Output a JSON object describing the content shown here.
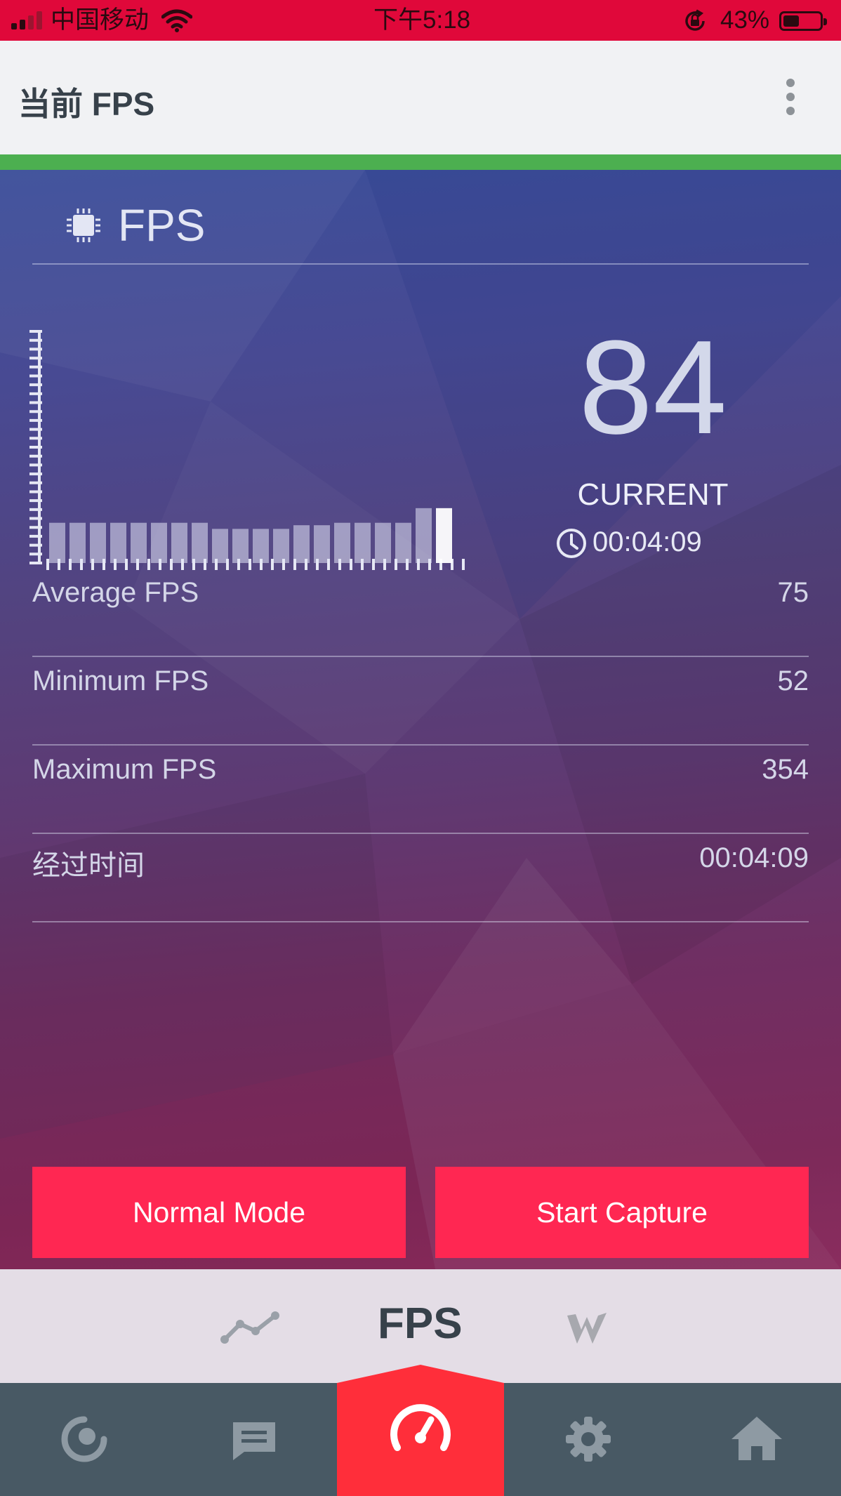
{
  "status_bar": {
    "carrier": "中国移动",
    "time": "下午5:18",
    "battery_text": "43%",
    "battery_level": 0.43,
    "icons": [
      "signal-icon",
      "wifi-icon",
      "rotation-lock-icon",
      "battery-icon"
    ]
  },
  "app_bar": {
    "title": "当前 FPS",
    "menu_icon": "more-vertical-icon"
  },
  "fps_panel": {
    "title": "FPS",
    "icon": "chip-icon",
    "current_value": "84",
    "current_label": "CURRENT",
    "current_time": "00:04:09",
    "clock_icon": "clock-icon"
  },
  "stats": [
    {
      "label": "Average FPS",
      "value": "75"
    },
    {
      "label": "Minimum FPS",
      "value": "52"
    },
    {
      "label": "Maximum FPS",
      "value": "354"
    },
    {
      "label": "经过时间",
      "value": "00:04:09"
    }
  ],
  "buttons": {
    "normal_mode": "Normal Mode",
    "start_capture": "Start Capture"
  },
  "sub_tabs": {
    "active_label": "FPS",
    "icons": [
      "trend-line-icon",
      "w-logo-icon"
    ]
  },
  "bottom_nav": {
    "icons": [
      "monitor-icon",
      "message-icon",
      "speedometer-icon",
      "gear-icon",
      "home-icon"
    ],
    "active": "speedometer-icon"
  },
  "colors": {
    "status_bar": "#e0083a",
    "accent_strip": "#4caf50",
    "button": "#ff2752",
    "nav_bg": "#485964",
    "nav_active": "#ff2e3a"
  },
  "chart_data": {
    "type": "bar",
    "values": [
      66,
      66,
      66,
      66,
      66,
      66,
      66,
      66,
      56,
      56,
      56,
      56,
      62,
      62,
      66,
      66,
      66,
      66,
      90,
      90
    ],
    "highlight_index": 19,
    "ylim": [
      0,
      380
    ]
  }
}
